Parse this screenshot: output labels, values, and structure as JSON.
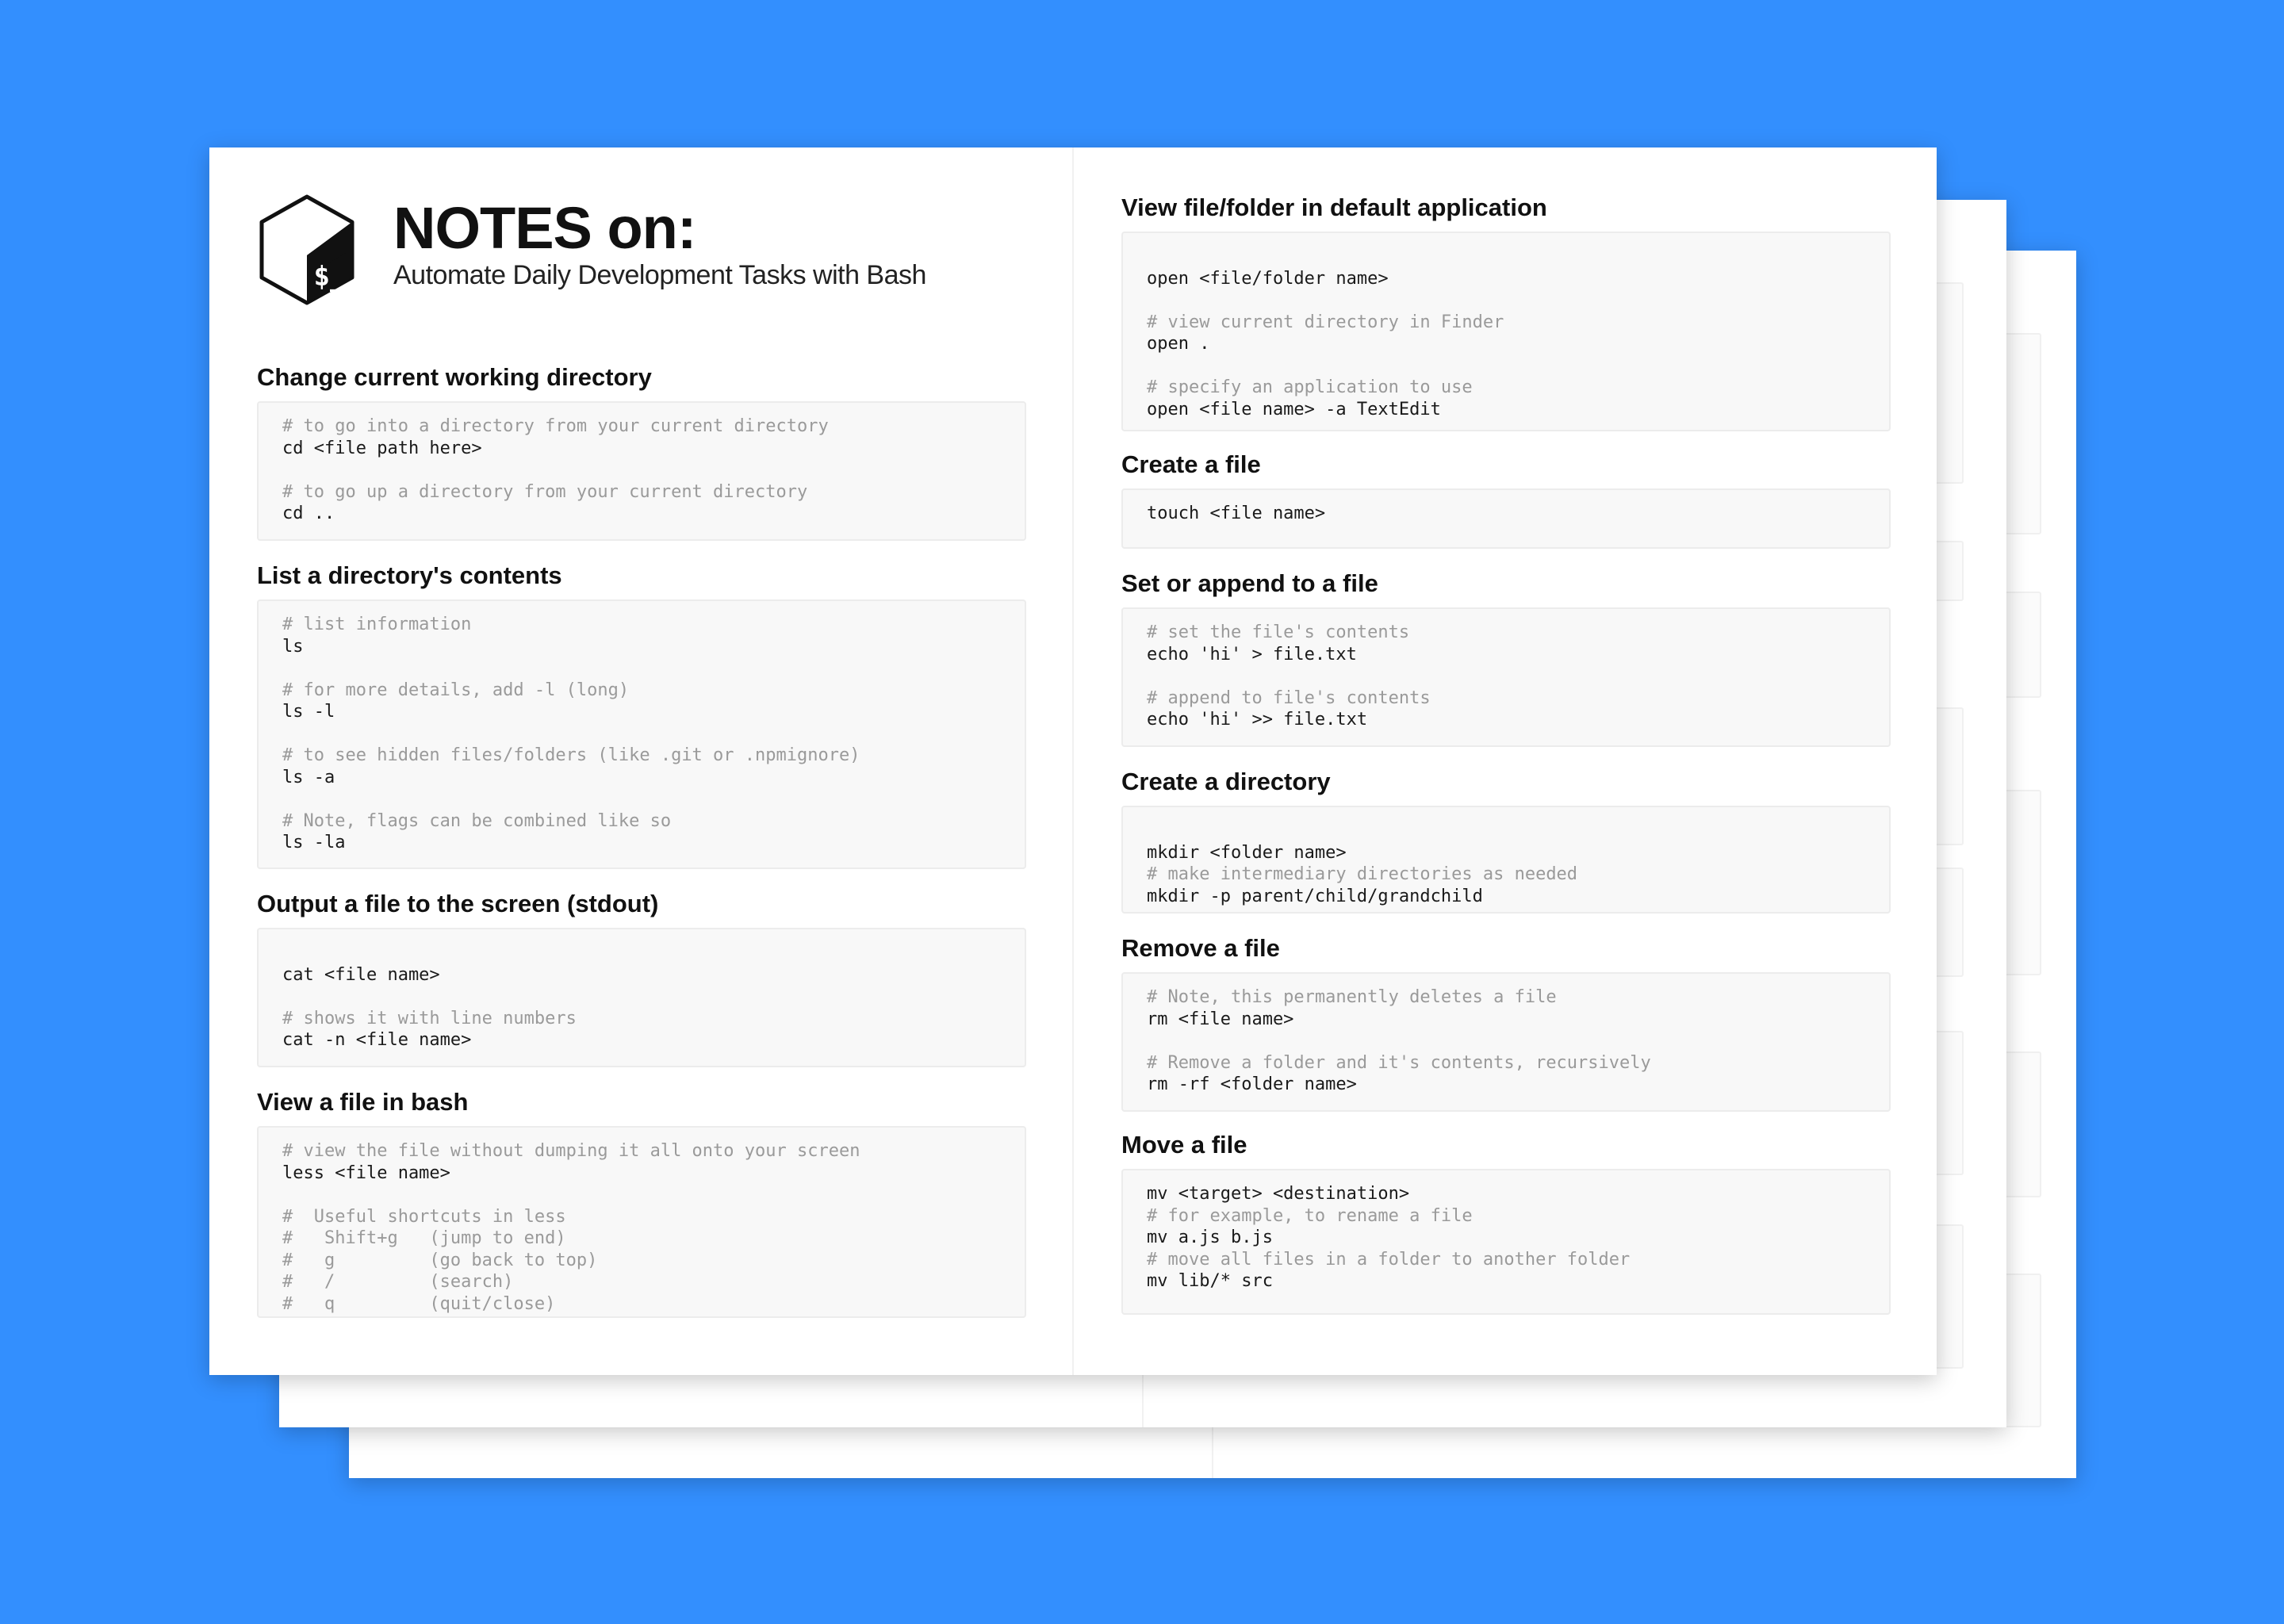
{
  "header": {
    "title": "NOTES on:",
    "subtitle": "Automate Daily Development Tasks with Bash",
    "logo_text": "$_"
  },
  "colors": {
    "background": "#338ffe",
    "paper": "#ffffff",
    "code_bg": "#f8f8f8",
    "comment": "#9a9a9a",
    "text": "#111111"
  },
  "sections_left": [
    {
      "heading": "Change current working directory",
      "lines": [
        {
          "text": "# to go into a directory from your current directory",
          "kind": "comment"
        },
        {
          "text": "cd <file path here>",
          "kind": "code"
        },
        {
          "text": "",
          "kind": "blank"
        },
        {
          "text": "# to go up a directory from your current directory",
          "kind": "comment"
        },
        {
          "text": "cd ..",
          "kind": "code"
        }
      ]
    },
    {
      "heading": "List a directory's contents",
      "lines": [
        {
          "text": "# list information",
          "kind": "comment"
        },
        {
          "text": "ls",
          "kind": "code"
        },
        {
          "text": "",
          "kind": "blank"
        },
        {
          "text": "# for more details, add -l (long)",
          "kind": "comment"
        },
        {
          "text": "ls -l",
          "kind": "code"
        },
        {
          "text": "",
          "kind": "blank"
        },
        {
          "text": "# to see hidden files/folders (like .git or .npmignore)",
          "kind": "comment"
        },
        {
          "text": "ls -a",
          "kind": "code"
        },
        {
          "text": "",
          "kind": "blank"
        },
        {
          "text": "# Note, flags can be combined like so",
          "kind": "comment"
        },
        {
          "text": "ls -la",
          "kind": "code"
        }
      ]
    },
    {
      "heading": "Output a file to the screen (stdout)",
      "lines": [
        {
          "text": "",
          "kind": "blank"
        },
        {
          "text": "cat <file name>",
          "kind": "code"
        },
        {
          "text": "",
          "kind": "blank"
        },
        {
          "text": "# shows it with line numbers",
          "kind": "comment"
        },
        {
          "text": "cat -n <file name>",
          "kind": "code"
        },
        {
          "text": "",
          "kind": "blank"
        }
      ]
    },
    {
      "heading": "View a file in bash",
      "lines": [
        {
          "text": "# view the file without dumping it all onto your screen",
          "kind": "comment"
        },
        {
          "text": "less <file name>",
          "kind": "code"
        },
        {
          "text": "",
          "kind": "blank"
        },
        {
          "text": "#  Useful shortcuts in less",
          "kind": "comment"
        },
        {
          "text": "#   Shift+g   (jump to end)",
          "kind": "comment"
        },
        {
          "text": "#   g         (go back to top)",
          "kind": "comment"
        },
        {
          "text": "#   /         (search)",
          "kind": "comment"
        },
        {
          "text": "#   q         (quit/close)",
          "kind": "comment"
        }
      ]
    }
  ],
  "sections_right": [
    {
      "heading": "View file/folder in default application",
      "lines": [
        {
          "text": "",
          "kind": "blank"
        },
        {
          "text": "open <file/folder name>",
          "kind": "code"
        },
        {
          "text": "",
          "kind": "blank"
        },
        {
          "text": "# view current directory in Finder",
          "kind": "comment"
        },
        {
          "text": "open .",
          "kind": "code"
        },
        {
          "text": "",
          "kind": "blank"
        },
        {
          "text": "# specify an application to use",
          "kind": "comment"
        },
        {
          "text": "open <file name> -a TextEdit",
          "kind": "code"
        }
      ]
    },
    {
      "heading": "Create a file",
      "lines": [
        {
          "text": "touch <file name>",
          "kind": "code"
        }
      ]
    },
    {
      "heading": "Set or append to a file",
      "lines": [
        {
          "text": "# set the file's contents",
          "kind": "comment"
        },
        {
          "text": "echo 'hi' > file.txt",
          "kind": "code"
        },
        {
          "text": "",
          "kind": "blank"
        },
        {
          "text": "# append to file's contents",
          "kind": "comment"
        },
        {
          "text": "echo 'hi' >> file.txt",
          "kind": "code"
        }
      ]
    },
    {
      "heading": "Create a directory",
      "lines": [
        {
          "text": "",
          "kind": "blank"
        },
        {
          "text": "mkdir <folder name>",
          "kind": "code"
        },
        {
          "text": "# make intermediary directories as needed",
          "kind": "comment"
        },
        {
          "text": "mkdir -p parent/child/grandchild",
          "kind": "code"
        }
      ]
    },
    {
      "heading": "Remove a file",
      "lines": [
        {
          "text": "# Note, this permanently deletes a file",
          "kind": "comment"
        },
        {
          "text": "rm <file name>",
          "kind": "code"
        },
        {
          "text": "",
          "kind": "blank"
        },
        {
          "text": "# Remove a folder and it's contents, recursively",
          "kind": "comment"
        },
        {
          "text": "rm -rf <folder name>",
          "kind": "code"
        }
      ]
    },
    {
      "heading": "Move a file",
      "lines": [
        {
          "text": "mv <target> <destination>",
          "kind": "code"
        },
        {
          "text": "# for example, to rename a file",
          "kind": "comment"
        },
        {
          "text": "mv a.js b.js",
          "kind": "code"
        },
        {
          "text": "# move all files in a folder to another folder",
          "kind": "comment"
        },
        {
          "text": "mv lib/* src",
          "kind": "code"
        }
      ]
    }
  ]
}
